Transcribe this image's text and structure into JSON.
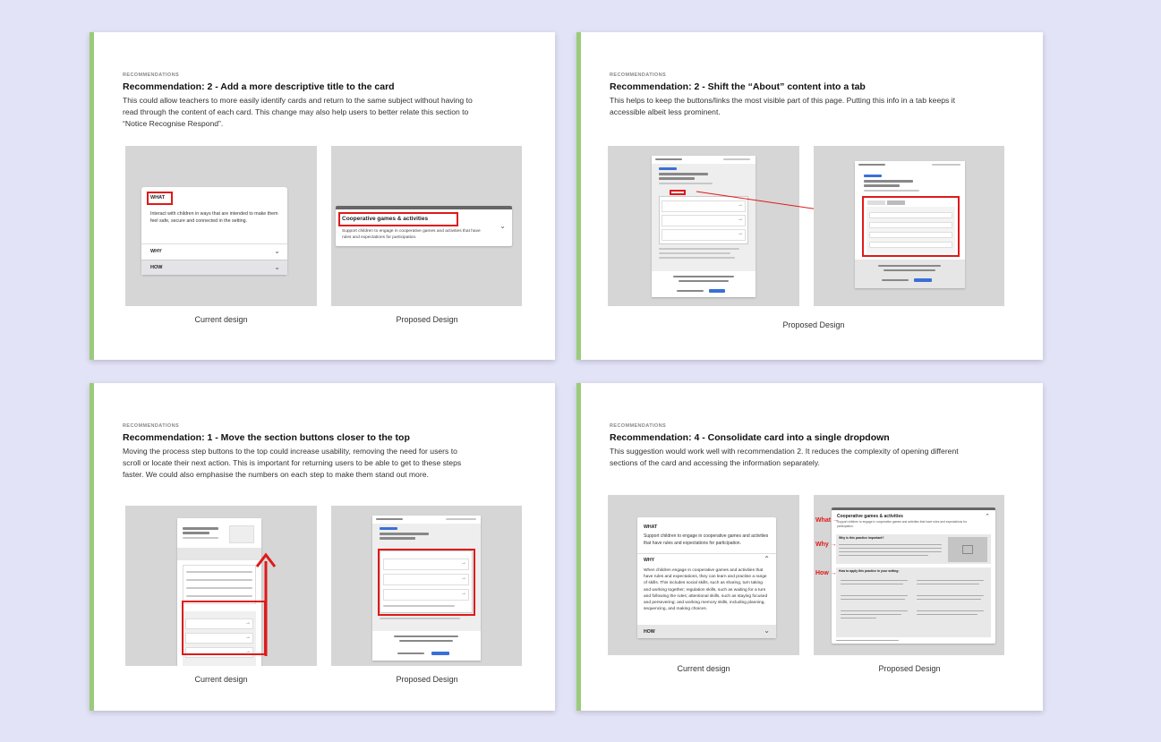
{
  "slides": [
    {
      "kicker": "RECOMMENDATIONS",
      "title": "Recommendation: 2 - Add a more descriptive title to the card",
      "description": "This could allow teachers to more easily identify cards and return to the same subject without having to read through the content of each card. This change may also help users to better relate this section to “Notice Recognise Respond”.",
      "current_caption": "Current design",
      "proposed_caption": "Proposed Design",
      "current_card": {
        "what_label": "WHAT",
        "what_text": "Interact with children in ways that are intended to make them feel safe, secure and connected in the setting.",
        "why_label": "WHY",
        "how_label": "HOW"
      },
      "proposed_card": {
        "title": "Cooperative games & activities",
        "text": "Support children to engage in cooperative games and activities that have rules and expectations for participation."
      }
    },
    {
      "kicker": "RECOMMENDATIONS",
      "title": "Recommendation: 2 - Shift the “About” content into a tab",
      "description": "This helps to keep the buttons/links the most visible part of this page. Putting this info in a tab keeps it accessible albeit less prominent.",
      "proposed_caption": "Proposed Design"
    },
    {
      "kicker": "RECOMMENDATIONS",
      "title": "Recommendation: 1 - Move the section buttons closer to the top",
      "description": "Moving the process step buttons to the top could increase usability, removing the need for users to scroll or locate their next action. This is important for returning users to be able to get to these steps faster. We could also emphasise the numbers on each step to make them stand out more.",
      "current_caption": "Current design",
      "proposed_caption": "Proposed Design"
    },
    {
      "kicker": "RECOMMENDATIONS",
      "title": "Recommendation: 4 - Consolidate card into a single dropdown",
      "description": "This suggestion would work well with recommendation 2. It reduces the complexity of opening different sections of the card and accessing the information separately.",
      "current_caption": "Current design",
      "proposed_caption": "Proposed Design",
      "current_card": {
        "what_label": "WHAT",
        "what_text": "Support children to engage in cooperative games and activities that have rules and expectations for participation.",
        "why_label": "WHY",
        "why_text": "When children engage in cooperative games and activities that have rules and expectations, they can learn and practise a range of skills. This includes social skills, such as sharing, turn taking and working together; regulation skills, such as waiting for a turn and following the rules; attentional skills, such as staying focused and persevering; and working memory skills, including planning, sequencing, and making choices.",
        "how_label": "HOW"
      },
      "proposed_card": {
        "title": "Cooperative games & activities",
        "subtitle": "Support children to engage in cooperative games and activities that have rules and expectations for participation.",
        "why_heading": "Why is this practice important?",
        "how_heading": "How to apply this practice in your setting:",
        "annot_what": "What",
        "annot_why": "Why",
        "annot_how": "How"
      }
    }
  ],
  "colors": {
    "accent_bar": "#9acb7a",
    "highlight_red": "#e01919",
    "panel_grey": "#d6d6d6",
    "background": "#e3e3f7",
    "title_text": "#111111"
  },
  "icons": [
    "chevron-down-icon",
    "chevron-up-icon",
    "arrow-right-icon",
    "image-placeholder-icon",
    "arrow-up-icon"
  ]
}
